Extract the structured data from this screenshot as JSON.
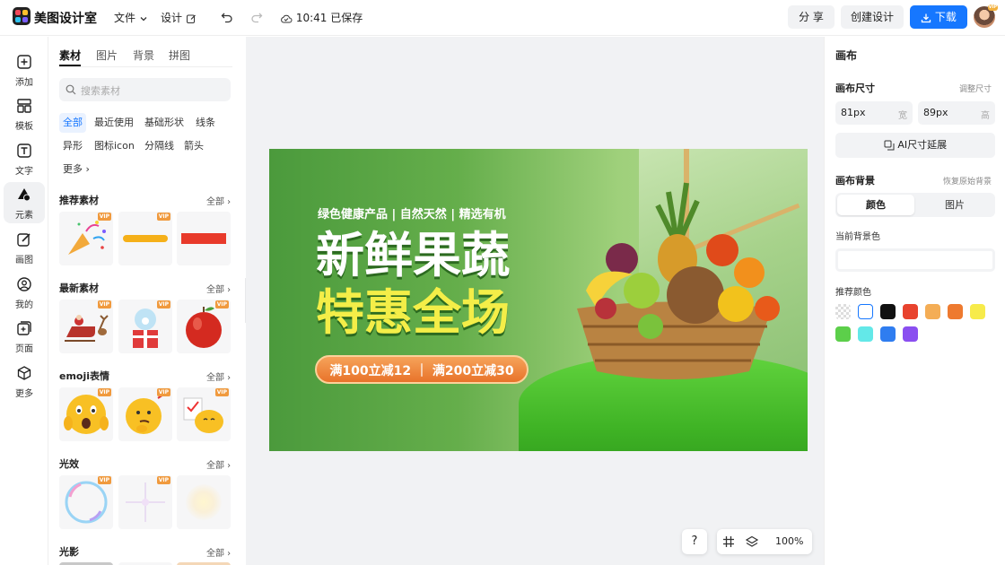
{
  "app": {
    "name": "美图设计室"
  },
  "topbar": {
    "file_menu": "文件",
    "design_menu": "设计",
    "save_status": "10:41 已保存",
    "share_label": "分 享",
    "create_label": "创建设计",
    "download_label": "下载",
    "avatar_badge": "VIP"
  },
  "left_nav": [
    {
      "label": "添加",
      "icon": "plus-square-icon"
    },
    {
      "label": "模板",
      "icon": "template-icon"
    },
    {
      "label": "文字",
      "icon": "text-icon"
    },
    {
      "label": "元素",
      "icon": "shapes-icon",
      "active": true
    },
    {
      "label": "画图",
      "icon": "pencil-icon"
    },
    {
      "label": "我的",
      "icon": "user-icon"
    },
    {
      "label": "页面",
      "icon": "page-add-icon"
    },
    {
      "label": "更多",
      "icon": "cube-icon"
    }
  ],
  "panel": {
    "tabs": [
      "素材",
      "图片",
      "背景",
      "拼图"
    ],
    "search_placeholder": "搜索素材",
    "chips": [
      "全部",
      "最近使用",
      "基础形状",
      "线条",
      "异形",
      "图标icon",
      "分隔线",
      "箭头",
      "更多"
    ],
    "all_label": "全部",
    "vip_label": "VIP",
    "sections": [
      {
        "title": "推荐素材"
      },
      {
        "title": "最新素材"
      },
      {
        "title": "emoji表情"
      },
      {
        "title": "光效"
      },
      {
        "title": "光影"
      }
    ]
  },
  "banner": {
    "tagline": "绿色健康产品 | 自然天然 | 精选有机",
    "headline1": "新鲜果蔬",
    "headline2": "特惠全场",
    "promo": "满100立减12 ｜ 满200立减30"
  },
  "canvas_controls": {
    "help": "?",
    "zoom": "100%"
  },
  "right_panel": {
    "title": "画布",
    "size_label": "画布尺寸",
    "adjust_size": "调整尺寸",
    "width_value": "81px",
    "width_unit": "宽",
    "height_value": "89px",
    "height_unit": "高",
    "ai_extend": "AI尺寸延展",
    "bg_label": "画布背景",
    "restore_bg": "恢复原始背景",
    "seg_color": "颜色",
    "seg_image": "图片",
    "current_bg_label": "当前背景色",
    "recommended_label": "推荐颜色",
    "swatches": [
      "transparent",
      "#ffffff",
      "#111111",
      "#e8432e",
      "#f4ad55",
      "#ee7a2f",
      "#f7eb4a",
      "#5ccf4a",
      "#63e8e8",
      "#2f7df0",
      "#8a4ff0"
    ]
  }
}
